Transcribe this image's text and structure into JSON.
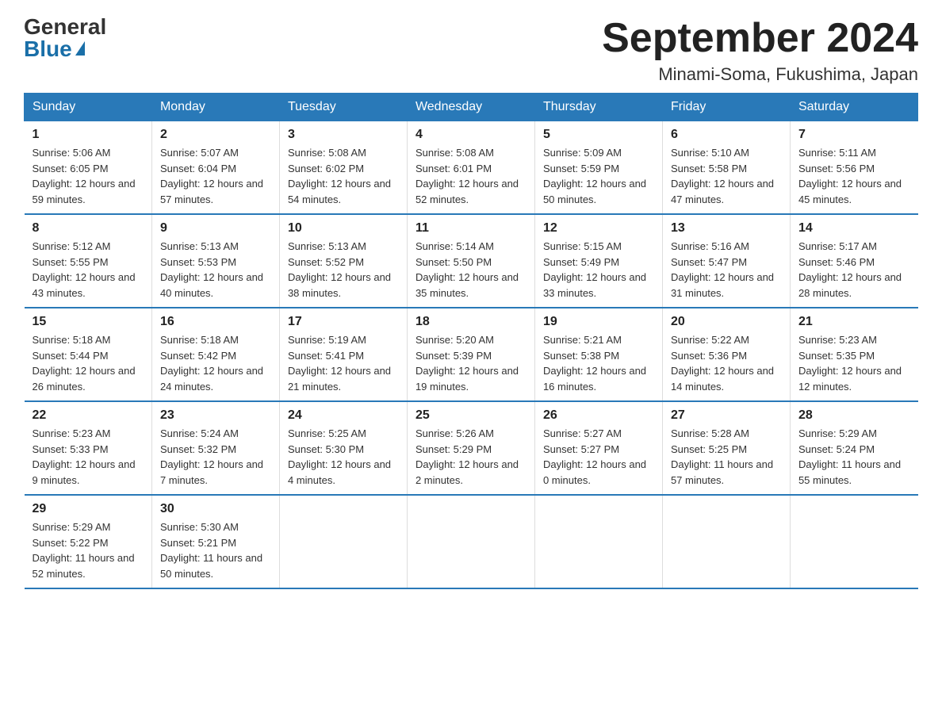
{
  "logo": {
    "general": "General",
    "blue": "Blue"
  },
  "title": "September 2024",
  "location": "Minami-Soma, Fukushima, Japan",
  "days_of_week": [
    "Sunday",
    "Monday",
    "Tuesday",
    "Wednesday",
    "Thursday",
    "Friday",
    "Saturday"
  ],
  "weeks": [
    [
      {
        "day": "1",
        "sunrise": "5:06 AM",
        "sunset": "6:05 PM",
        "daylight": "12 hours and 59 minutes."
      },
      {
        "day": "2",
        "sunrise": "5:07 AM",
        "sunset": "6:04 PM",
        "daylight": "12 hours and 57 minutes."
      },
      {
        "day": "3",
        "sunrise": "5:08 AM",
        "sunset": "6:02 PM",
        "daylight": "12 hours and 54 minutes."
      },
      {
        "day": "4",
        "sunrise": "5:08 AM",
        "sunset": "6:01 PM",
        "daylight": "12 hours and 52 minutes."
      },
      {
        "day": "5",
        "sunrise": "5:09 AM",
        "sunset": "5:59 PM",
        "daylight": "12 hours and 50 minutes."
      },
      {
        "day": "6",
        "sunrise": "5:10 AM",
        "sunset": "5:58 PM",
        "daylight": "12 hours and 47 minutes."
      },
      {
        "day": "7",
        "sunrise": "5:11 AM",
        "sunset": "5:56 PM",
        "daylight": "12 hours and 45 minutes."
      }
    ],
    [
      {
        "day": "8",
        "sunrise": "5:12 AM",
        "sunset": "5:55 PM",
        "daylight": "12 hours and 43 minutes."
      },
      {
        "day": "9",
        "sunrise": "5:13 AM",
        "sunset": "5:53 PM",
        "daylight": "12 hours and 40 minutes."
      },
      {
        "day": "10",
        "sunrise": "5:13 AM",
        "sunset": "5:52 PM",
        "daylight": "12 hours and 38 minutes."
      },
      {
        "day": "11",
        "sunrise": "5:14 AM",
        "sunset": "5:50 PM",
        "daylight": "12 hours and 35 minutes."
      },
      {
        "day": "12",
        "sunrise": "5:15 AM",
        "sunset": "5:49 PM",
        "daylight": "12 hours and 33 minutes."
      },
      {
        "day": "13",
        "sunrise": "5:16 AM",
        "sunset": "5:47 PM",
        "daylight": "12 hours and 31 minutes."
      },
      {
        "day": "14",
        "sunrise": "5:17 AM",
        "sunset": "5:46 PM",
        "daylight": "12 hours and 28 minutes."
      }
    ],
    [
      {
        "day": "15",
        "sunrise": "5:18 AM",
        "sunset": "5:44 PM",
        "daylight": "12 hours and 26 minutes."
      },
      {
        "day": "16",
        "sunrise": "5:18 AM",
        "sunset": "5:42 PM",
        "daylight": "12 hours and 24 minutes."
      },
      {
        "day": "17",
        "sunrise": "5:19 AM",
        "sunset": "5:41 PM",
        "daylight": "12 hours and 21 minutes."
      },
      {
        "day": "18",
        "sunrise": "5:20 AM",
        "sunset": "5:39 PM",
        "daylight": "12 hours and 19 minutes."
      },
      {
        "day": "19",
        "sunrise": "5:21 AM",
        "sunset": "5:38 PM",
        "daylight": "12 hours and 16 minutes."
      },
      {
        "day": "20",
        "sunrise": "5:22 AM",
        "sunset": "5:36 PM",
        "daylight": "12 hours and 14 minutes."
      },
      {
        "day": "21",
        "sunrise": "5:23 AM",
        "sunset": "5:35 PM",
        "daylight": "12 hours and 12 minutes."
      }
    ],
    [
      {
        "day": "22",
        "sunrise": "5:23 AM",
        "sunset": "5:33 PM",
        "daylight": "12 hours and 9 minutes."
      },
      {
        "day": "23",
        "sunrise": "5:24 AM",
        "sunset": "5:32 PM",
        "daylight": "12 hours and 7 minutes."
      },
      {
        "day": "24",
        "sunrise": "5:25 AM",
        "sunset": "5:30 PM",
        "daylight": "12 hours and 4 minutes."
      },
      {
        "day": "25",
        "sunrise": "5:26 AM",
        "sunset": "5:29 PM",
        "daylight": "12 hours and 2 minutes."
      },
      {
        "day": "26",
        "sunrise": "5:27 AM",
        "sunset": "5:27 PM",
        "daylight": "12 hours and 0 minutes."
      },
      {
        "day": "27",
        "sunrise": "5:28 AM",
        "sunset": "5:25 PM",
        "daylight": "11 hours and 57 minutes."
      },
      {
        "day": "28",
        "sunrise": "5:29 AM",
        "sunset": "5:24 PM",
        "daylight": "11 hours and 55 minutes."
      }
    ],
    [
      {
        "day": "29",
        "sunrise": "5:29 AM",
        "sunset": "5:22 PM",
        "daylight": "11 hours and 52 minutes."
      },
      {
        "day": "30",
        "sunrise": "5:30 AM",
        "sunset": "5:21 PM",
        "daylight": "11 hours and 50 minutes."
      },
      null,
      null,
      null,
      null,
      null
    ]
  ]
}
